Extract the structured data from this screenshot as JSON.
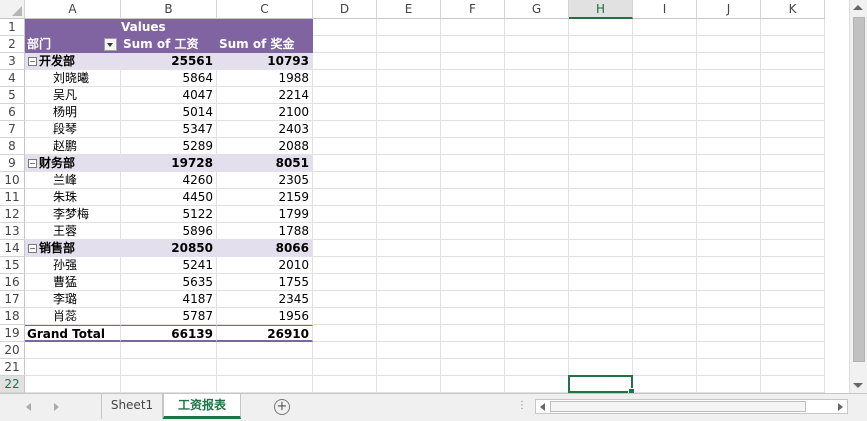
{
  "sheet": {
    "columns": [
      "A",
      "B",
      "C",
      "D",
      "E",
      "F",
      "G",
      "H",
      "I",
      "J",
      "K"
    ],
    "active_column": "H",
    "row_numbers": [
      "1",
      "2",
      "3",
      "4",
      "5",
      "6",
      "7",
      "8",
      "9",
      "10",
      "11",
      "12",
      "13",
      "14",
      "15",
      "16",
      "17",
      "18",
      "19",
      "20",
      "21",
      "22"
    ],
    "active_row": "22"
  },
  "pivot": {
    "values_label": "Values",
    "row_field_label": "部门",
    "col_headers": [
      "Sum of 工资",
      "Sum of 奖金"
    ],
    "groups": [
      {
        "name": "开发部",
        "salary": "25561",
        "bonus": "10793",
        "items": [
          {
            "name": "刘晓曦",
            "salary": "5864",
            "bonus": "1988"
          },
          {
            "name": "吴凡",
            "salary": "4047",
            "bonus": "2214"
          },
          {
            "name": "杨明",
            "salary": "5014",
            "bonus": "2100"
          },
          {
            "name": "段琴",
            "salary": "5347",
            "bonus": "2403"
          },
          {
            "name": "赵鹏",
            "salary": "5289",
            "bonus": "2088"
          }
        ]
      },
      {
        "name": "财务部",
        "salary": "19728",
        "bonus": "8051",
        "items": [
          {
            "name": "兰峰",
            "salary": "4260",
            "bonus": "2305"
          },
          {
            "name": "朱珠",
            "salary": "4450",
            "bonus": "2159"
          },
          {
            "name": "李梦梅",
            "salary": "5122",
            "bonus": "1799"
          },
          {
            "name": "王蓉",
            "salary": "5896",
            "bonus": "1788"
          }
        ]
      },
      {
        "name": "销售部",
        "salary": "20850",
        "bonus": "8066",
        "items": [
          {
            "name": "孙强",
            "salary": "5241",
            "bonus": "2010"
          },
          {
            "name": "曹猛",
            "salary": "5635",
            "bonus": "1755"
          },
          {
            "name": "李璐",
            "salary": "4187",
            "bonus": "2345"
          },
          {
            "name": "肖蕊",
            "salary": "5787",
            "bonus": "1956"
          }
        ]
      }
    ],
    "grand_total_label": "Grand Total",
    "grand_total_salary": "66139",
    "grand_total_bonus": "26910",
    "collapse_symbol": "−"
  },
  "tabs": {
    "items": [
      "Sheet1",
      "工资报表"
    ],
    "active_index": 1,
    "add_symbol": "+",
    "ellipsis": "⋮"
  },
  "colors": {
    "pivot_header": "#8064a2",
    "dept_band": "#e4dfec",
    "excel_green": "#217346"
  }
}
